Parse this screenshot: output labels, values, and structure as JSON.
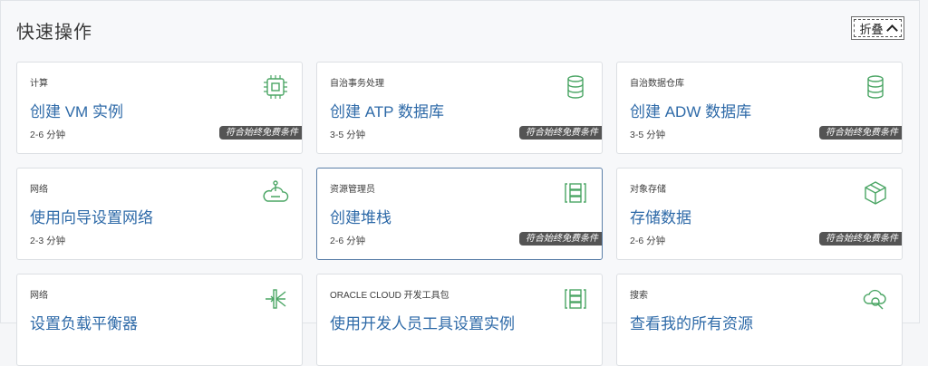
{
  "header": {
    "title": "快速操作",
    "collapse_label": "折叠"
  },
  "colors": {
    "accent": "#2e6aa8",
    "icon_green": "#4aa564",
    "badge_bg": "#545454"
  },
  "cards": [
    {
      "category": "计算",
      "name": "创建 VM 实例",
      "duration": "2-6 分钟",
      "badge": "符合始终免费条件",
      "icon": "chip-icon"
    },
    {
      "category": "自治事务处理",
      "name": "创建 ATP 数据库",
      "duration": "3-5 分钟",
      "badge": "符合始终免费条件",
      "icon": "database-icon"
    },
    {
      "category": "自治数据仓库",
      "name": "创建 ADW 数据库",
      "duration": "3-5 分钟",
      "badge": "符合始终免费条件",
      "icon": "database-icon"
    },
    {
      "category": "网络",
      "name": "使用向导设置网络",
      "duration": "2-3 分钟",
      "badge": "",
      "icon": "network-cloud-icon"
    },
    {
      "category": "资源管理员",
      "name": "创建堆栈",
      "duration": "2-6 分钟",
      "badge": "符合始终免费条件",
      "icon": "stack-icon"
    },
    {
      "category": "对象存储",
      "name": "存储数据",
      "duration": "2-6 分钟",
      "badge": "符合始终免费条件",
      "icon": "storage-cube-icon"
    },
    {
      "category": "网络",
      "name": "设置负载平衡器",
      "duration": "",
      "badge": "",
      "icon": "load-balancer-icon"
    },
    {
      "category": "ORACLE CLOUD 开发工具包",
      "name": "使用开发人员工具设置实例",
      "duration": "",
      "badge": "",
      "icon": "stack-icon"
    },
    {
      "category": "搜索",
      "name": "查看我的所有资源",
      "duration": "",
      "badge": "",
      "icon": "search-cloud-icon"
    }
  ]
}
